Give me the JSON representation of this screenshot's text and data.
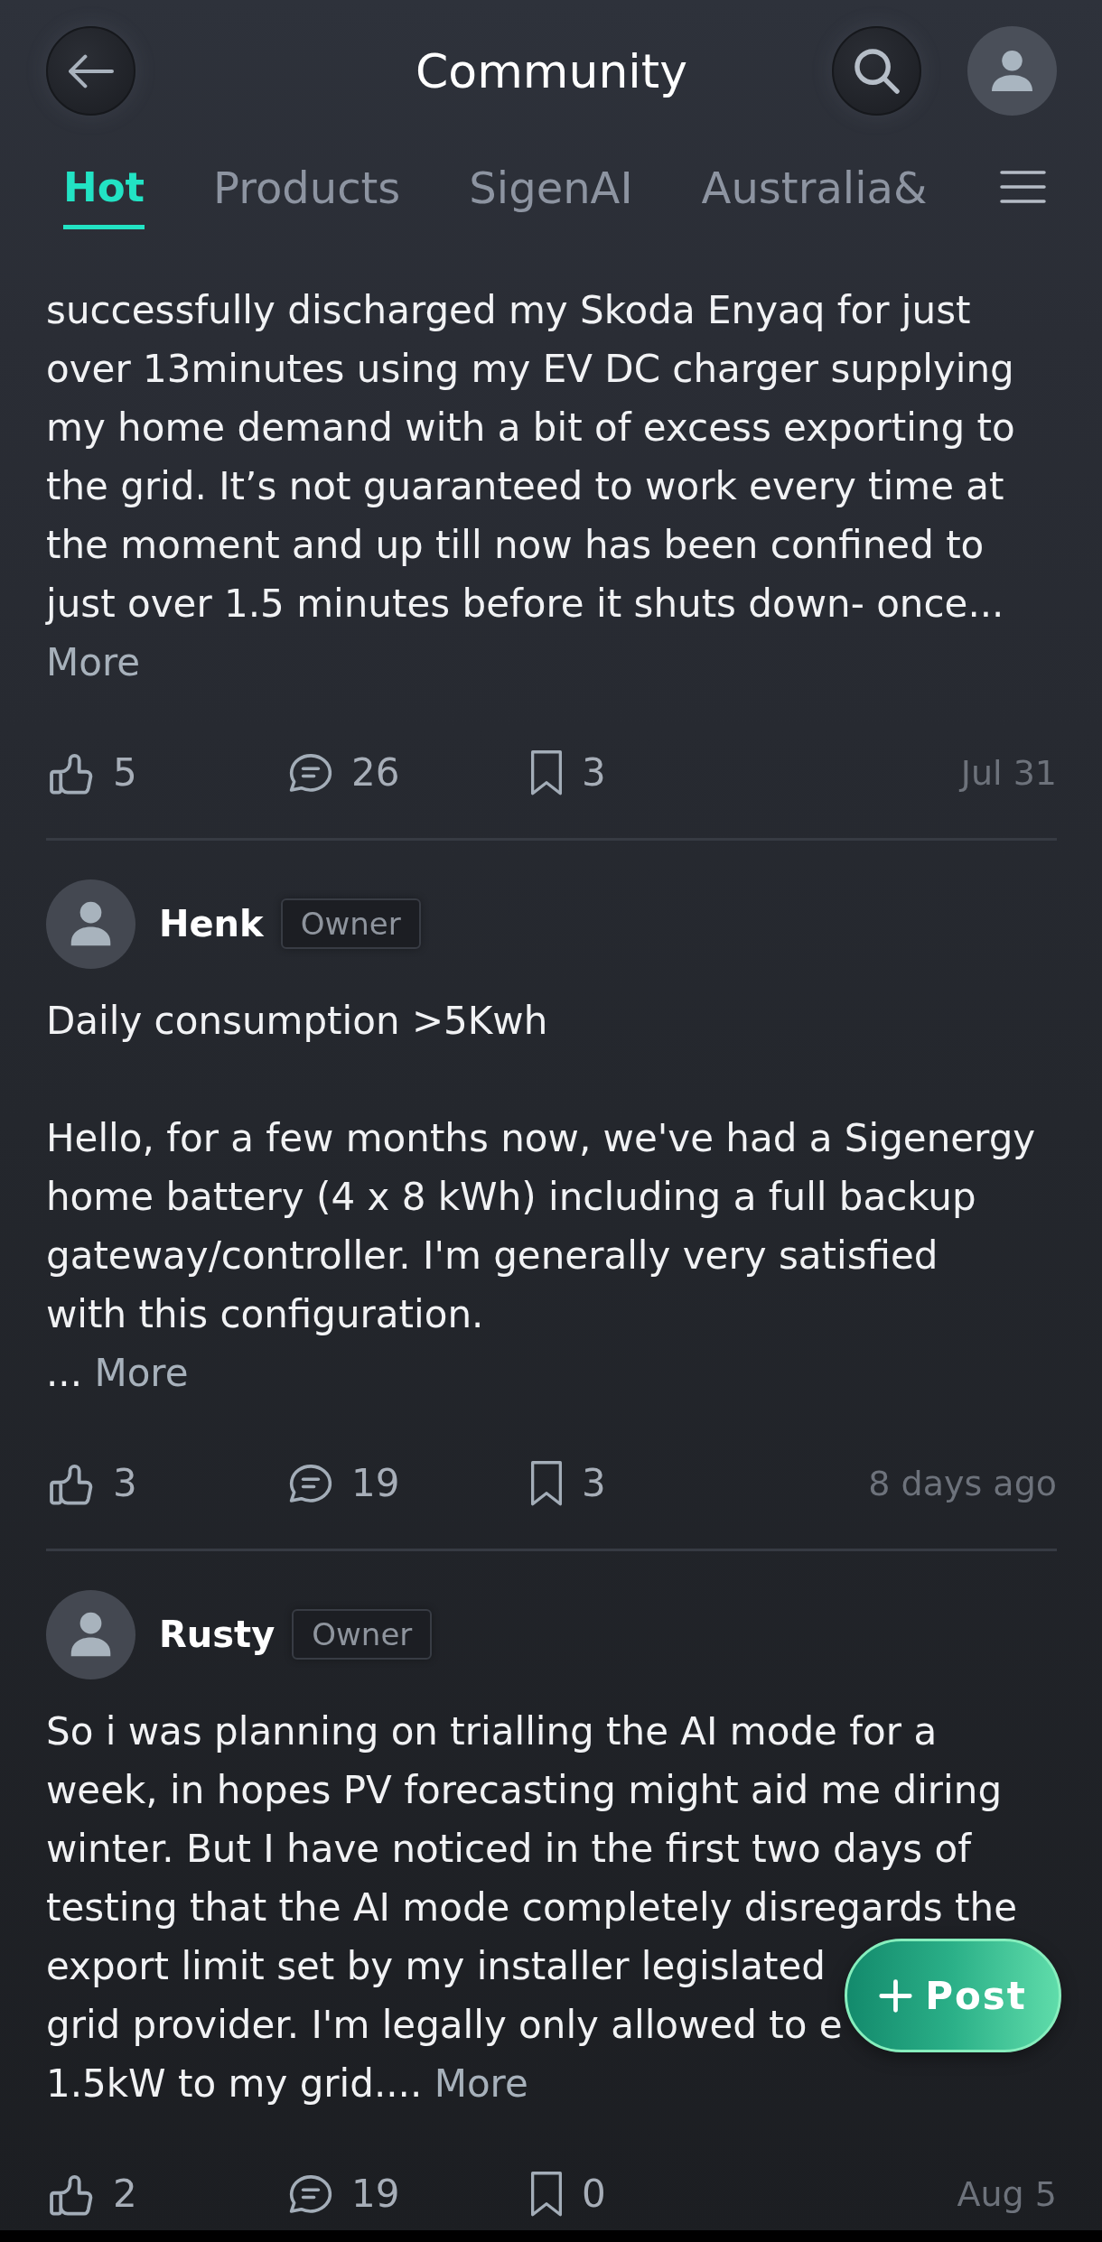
{
  "header": {
    "title": "Community"
  },
  "tabs": [
    {
      "label": "Hot",
      "selected": true
    },
    {
      "label": "Products",
      "selected": false
    },
    {
      "label": "SigenAI",
      "selected": false
    },
    {
      "label": "Australia&",
      "selected": false
    }
  ],
  "posts": [
    {
      "body": [
        "successfully discharged my Skoda Enyaq for just\nover 13minutes using my EV DC charger supplying\nmy home demand with a bit of excess exporting to\nthe grid. It’s not guaranteed to work every time at\nthe moment and up till now has been confined to\njust over 1.5 minutes before it shuts down- once..."
      ],
      "more": "More",
      "likes": "5",
      "comments": "26",
      "bookmarks": "3",
      "date": "Jul 31"
    },
    {
      "author": "Henk",
      "badge": "Owner",
      "body": [
        "Daily consumption >5Kwh\n\nHello, for a few months now, we've had a Sigenergy\nhome battery (4 x 8 kWh) including a full backup\ngateway/controller. I'm generally very satisfied\nwith this configuration.\n..."
      ],
      "more": "More",
      "likes": "3",
      "comments": "19",
      "bookmarks": "3",
      "date": "8 days ago"
    },
    {
      "author": "Rusty",
      "badge": "Owner",
      "body": [
        "So i was planning on trialling the AI mode for a\nweek, in hopes PV forecasting might aid me diring\nwinter. But I have noticed in the first two days of\ntesting that the AI mode completely disregards the",
        "export limit set by my installer legislated\ngrid provider. I'm legally only allowed to e\n1.5kW to my grid...."
      ],
      "more": "More",
      "likes": "2",
      "comments": "19",
      "bookmarks": "0",
      "date": "Aug 5"
    }
  ],
  "post_button": {
    "label": "Post"
  }
}
